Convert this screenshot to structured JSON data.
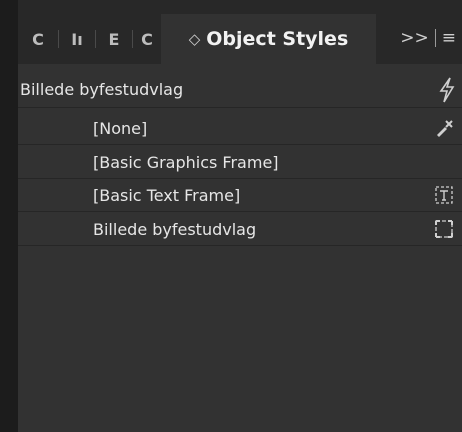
{
  "tabs": [
    {
      "label": "C"
    },
    {
      "label": "Iı"
    },
    {
      "label": "E"
    },
    {
      "label": "C"
    },
    {
      "label": "Object Styles",
      "updown_glyph": "◇"
    }
  ],
  "tab_overflow": {
    "glyph": ">>",
    "menu_glyph": "≡"
  },
  "group": {
    "label": "Billede byfestudvlag",
    "icon": "lightning-icon"
  },
  "styles": [
    {
      "label": "[None]",
      "icon": "pen-x-icon"
    },
    {
      "label": "[Basic Graphics Frame]",
      "icon": ""
    },
    {
      "label": "[Basic Text Frame]",
      "icon": "text-frame-icon"
    },
    {
      "label": "Billede byfestudvlag",
      "icon": "graphics-frame-icon"
    }
  ],
  "colors": {
    "panel_bg": "#323232",
    "tabbar_bg": "#282828",
    "text": "#e6e6e6"
  }
}
